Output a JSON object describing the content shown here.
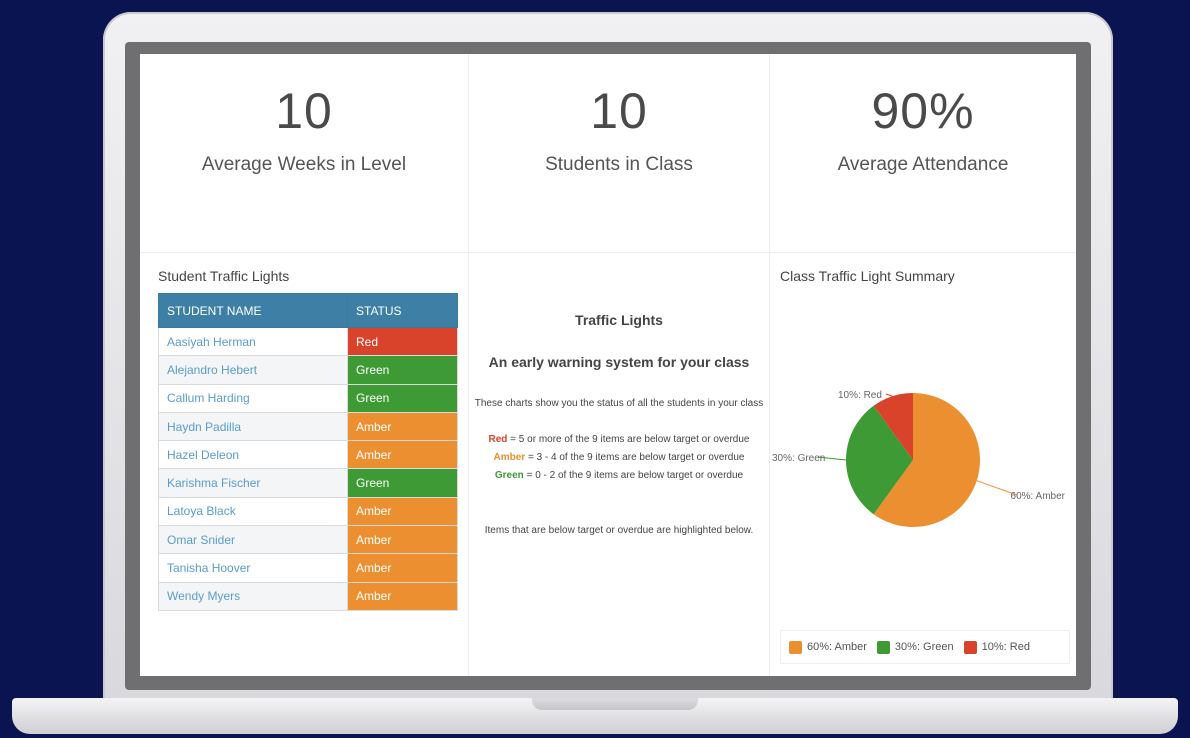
{
  "stats": [
    {
      "value": "10",
      "label": "Average Weeks in Level"
    },
    {
      "value": "10",
      "label": "Students in Class"
    },
    {
      "value": "90%",
      "label": "Average Attendance"
    }
  ],
  "traffic_table": {
    "title": "Student Traffic Lights",
    "headers": {
      "name": "STUDENT NAME",
      "status": "STATUS"
    },
    "rows": [
      {
        "name": "Aasiyah Herman",
        "status": "Red"
      },
      {
        "name": "Alejandro Hebert",
        "status": "Green"
      },
      {
        "name": "Callum Harding",
        "status": "Green"
      },
      {
        "name": "Haydn Padilla",
        "status": "Amber"
      },
      {
        "name": "Hazel Deleon",
        "status": "Amber"
      },
      {
        "name": "Karishma Fischer",
        "status": "Green"
      },
      {
        "name": "Latoya Black",
        "status": "Amber"
      },
      {
        "name": "Omar Snider",
        "status": "Amber"
      },
      {
        "name": "Tanisha Hoover",
        "status": "Amber"
      },
      {
        "name": "Wendy Myers",
        "status": "Amber"
      }
    ]
  },
  "info": {
    "title": "Traffic Lights",
    "subtitle": "An early warning system for your class",
    "description": "These charts show you the status of all the students in your class",
    "red_word": "Red",
    "red_text": " = 5 or more of the 9 items are below target or overdue",
    "amber_word": "Amber",
    "amber_text": " = 3 - 4 of the 9 items are below target or overdue",
    "green_word": "Green",
    "green_text": " = 0 - 2 of the 9 items are below target or overdue",
    "note": "Items that are below target or overdue are highlighted below."
  },
  "colors": {
    "Red": "#d9432c",
    "Green": "#3e9a35",
    "Amber": "#ec8f31"
  },
  "summary_title": "Class Traffic Light Summary",
  "chart_data": {
    "type": "pie",
    "title": "Class Traffic Light Summary",
    "slices": [
      {
        "label": "60%: Amber",
        "value": 60,
        "color": "#ec8f31"
      },
      {
        "label": "30%: Green",
        "value": 30,
        "color": "#3e9a35"
      },
      {
        "label": "10%: Red",
        "value": 10,
        "color": "#d9432c"
      }
    ],
    "legend": "bottom"
  }
}
